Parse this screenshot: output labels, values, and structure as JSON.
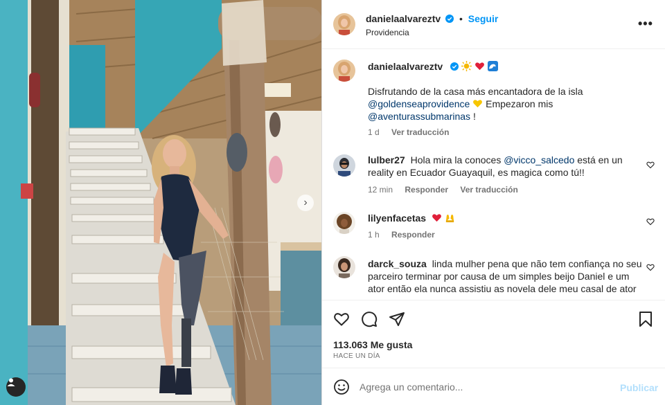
{
  "post": {
    "author": "danielaalvareztv",
    "separator": "•",
    "follow_label": "Seguir",
    "location": "Providencia",
    "more_icon": "more-horizontal-icon",
    "more_label": "•••"
  },
  "caption": {
    "author": "danielaalvareztv",
    "emojis": [
      "sun-emoji",
      "red-heart-emoji",
      "wave-emoji"
    ],
    "line1": "Disfrutando de la casa más encantadora de la isla",
    "mention1": "@goldenseaprovidence",
    "line2_after": "Empezaron mis",
    "mention2": "@aventurassubmarinas",
    "line3_after": " !",
    "time": "1 d",
    "translate_label": "Ver traducción"
  },
  "comments": [
    {
      "user": "lulber27",
      "text_before": "Hola mira la conoces ",
      "mention": "@vicco_salcedo",
      "text_after": " está en un reality en Ecuador Guayaquil, es magica como tú!!",
      "time": "12 min",
      "reply_label": "Responder",
      "translate_label": "Ver traducción"
    },
    {
      "user": "lilyenfacetas",
      "emojis": [
        "red-heart-emoji",
        "praise-hands-emoji"
      ],
      "time": "1 h",
      "reply_label": "Responder"
    },
    {
      "user": "darck_souza",
      "text": "linda mulher pena que não tem confiança no seu parceiro terminar por causa de um simples beijo Daniel e um ator então ela nunca assistiu as novela dele meu casal de ator"
    }
  ],
  "actions": {
    "like_icon": "heart-icon",
    "comment_icon": "comment-icon",
    "share_icon": "send-icon",
    "save_icon": "bookmark-icon"
  },
  "likes_text": "113.063 Me gusta",
  "posted_ago": "HACE UN DÍA",
  "composer": {
    "placeholder": "Agrega un comentario...",
    "publish_label": "Publicar",
    "emoji_icon": "smiley-icon"
  },
  "photo": {
    "next_icon": "chevron-right-icon",
    "next_label": "›",
    "tag_icon": "user-tag-icon"
  },
  "colors": {
    "accent": "#0095f6",
    "link": "#00376b",
    "publish_disabled": "#b2dffc",
    "muted": "#737373",
    "text": "#262626",
    "verified": "#0095f6"
  }
}
